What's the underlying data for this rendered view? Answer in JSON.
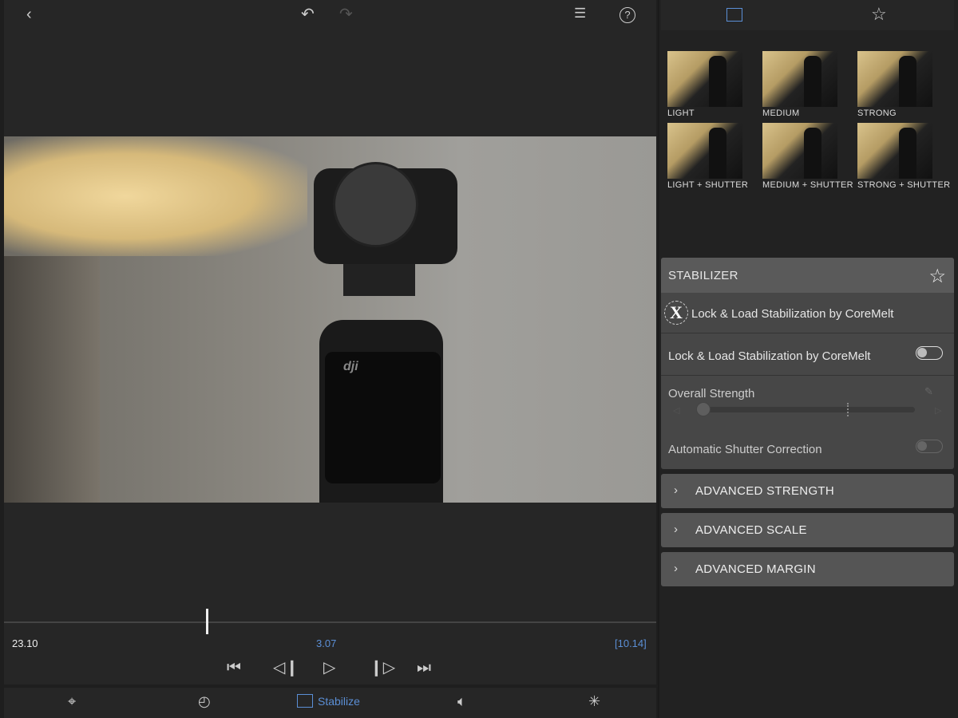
{
  "topbar": {
    "back_icon": "chevron-left",
    "undo_icon": "undo",
    "redo_icon": "redo",
    "clipboard_icon": "clipboard",
    "help_icon": "question-circle"
  },
  "panel_tabs": [
    {
      "icon": "stabilize-frame",
      "active": true
    },
    {
      "icon": "star"
    }
  ],
  "presets": [
    {
      "label": "LIGHT"
    },
    {
      "label": "MEDIUM"
    },
    {
      "label": "STRONG"
    },
    {
      "label": "LIGHT + SHUTTER"
    },
    {
      "label": "MEDIUM + SHUTTER"
    },
    {
      "label": "STRONG + SHUTTER"
    }
  ],
  "stabilizer": {
    "title": "STABILIZER",
    "plugin_name": "Lock & Load Stabilization by CoreMelt",
    "enable_label": "Lock & Load Stabilization by CoreMelt",
    "enable_on": false,
    "strength_label": "Overall Strength",
    "strength_value": 0,
    "shutter_label": "Automatic Shutter Correction",
    "shutter_on": false
  },
  "advanced": [
    {
      "label": "ADVANCED STRENGTH"
    },
    {
      "label": "ADVANCED SCALE"
    },
    {
      "label": "ADVANCED MARGIN"
    }
  ],
  "timeline": {
    "left_time": "23.10",
    "current_time": "3.07",
    "right_time": "[10.14]",
    "playhead_fraction": 0.31
  },
  "bottom_tabs": [
    {
      "icon": "crop-target"
    },
    {
      "icon": "speed-gauge"
    },
    {
      "icon": "stabilize-frame",
      "label": "Stabilize",
      "active": true
    },
    {
      "icon": "speaker"
    },
    {
      "icon": "effects"
    }
  ],
  "colors": {
    "accent": "#5b8fd6",
    "panel": "#474747",
    "header": "#5a5a5a"
  }
}
